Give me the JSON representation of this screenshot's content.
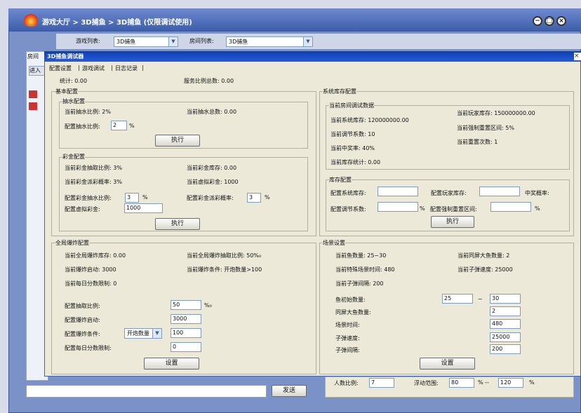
{
  "window": {
    "title": "游戏大厅 > 3D捕鱼 > 3D捕鱼 (仅限调试使用)"
  },
  "topbar": {
    "game_list_label": "游戏列表:",
    "game_list_value": "3D捕鱼",
    "room_list_label": "房间列表:",
    "room_list_value": "3D捕鱼"
  },
  "left": {
    "room_label": "房间",
    "enter_label": "进入"
  },
  "debugger": {
    "title": "3D捕鱼调试器",
    "tabs": [
      "配置设置",
      "游戏调试",
      "日志记录"
    ],
    "stats_label": "统计: 0.00",
    "service_ratio": "服务比例总数: 0.00"
  },
  "basic": {
    "title": "基本配置",
    "pump": {
      "title": "抽水配置",
      "cur_ratio": "当前抽水比例: 2%",
      "cur_total": "当前抽水总数: 0.00",
      "cfg_label": "配置抽水比例:",
      "cfg_value": "2",
      "unit": "%",
      "exec": "执行"
    },
    "jackpot": {
      "title": "彩金配置",
      "cur_ratio": "当前彩金抽取比例: 3%",
      "cur_stock": "当前彩金库存: 0.00",
      "cur_rate": "当前彩金派彩概率: 3%",
      "cur_virtual": "当前虚拟彩金: 1000",
      "cfg_ratio_label": "配置彩金抽水比例:",
      "cfg_ratio_value": "3",
      "cfg_rate_label": "配置彩金派彩概率:",
      "cfg_rate_value": "3",
      "cfg_virtual_label": "配置虚拟彩金:",
      "cfg_virtual_value": "1000",
      "unit": "%",
      "exec": "执行"
    }
  },
  "stock": {
    "title": "系统库存配置",
    "room": {
      "title": "当前房间调试数据",
      "sys_stock": "当前系统库存: 120000000.00",
      "player_stock": "当前玩家库存: 150000000.00",
      "adjust": "当前调节系数: 10",
      "reset_range": "当前强制重置区间: 5%",
      "win_rate": "当前中奖率: 40%",
      "reset_count": "当前重置次数: 1",
      "stock_stat": "当前库存统计: 0.00"
    },
    "cfg": {
      "title": "库存配置",
      "sys_label": "配置系统库存:",
      "player_label": "配置玩家库存:",
      "win_label": "中奖概率:",
      "adjust_label": "配置调节系数:",
      "reset_label": "配置强制重置区间:",
      "unit": "%",
      "exec": "执行"
    }
  },
  "explode": {
    "title": "全局爆炸配置",
    "cur_stock": "当前全局爆炸库存: 0.00",
    "cur_ratio": "当前全局爆炸抽取比例: 50%₀",
    "cur_start": "当前爆炸启动: 3000",
    "cur_cond": "当前爆炸条件: 开炮数量>100",
    "cur_limit": "当前每日分数限制: 0",
    "cfg_ratio_label": "配置抽取比例:",
    "cfg_ratio_value": "50",
    "ratio_unit": "%₀",
    "cfg_start_label": "配置爆炸启动:",
    "cfg_start_value": "3000",
    "cfg_cond_label": "配置爆炸条件:",
    "cfg_cond_select": "开炮数量",
    "cfg_cond_value": "100",
    "cfg_limit_label": "配置每日分数限制:",
    "cfg_limit_value": "0",
    "set": "设置"
  },
  "scene": {
    "title": "场景设置",
    "fish_count": "当前鱼数量: 25~30",
    "big_fish": "当前同屏大鱼数量: 2",
    "special_time": "当前特殊场景时间: 480",
    "bullet_speed": "当前子弹速度: 25000",
    "bullet_interval": "当前子弹间隔: 200",
    "init_fish_label": "鱼初始数量:",
    "init_fish_min": "25",
    "tilde": "~",
    "init_fish_max": "30",
    "big_fish_label": "同屏大鱼数量:",
    "big_fish_value": "2",
    "scene_time_label": "场景时间:",
    "scene_time_value": "480",
    "speed_label": "子弹速度:",
    "speed_value": "25000",
    "interval_label": "子弹间隔:",
    "interval_value": "200",
    "set": "设置"
  },
  "extra": {
    "ratio_label": "人数比例:",
    "ratio_value": "7",
    "float_label": "浮动范围:",
    "float_min": "80",
    "float_sep": "% --",
    "float_max": "120",
    "unit": "%"
  },
  "chat": {
    "send": "发送"
  }
}
